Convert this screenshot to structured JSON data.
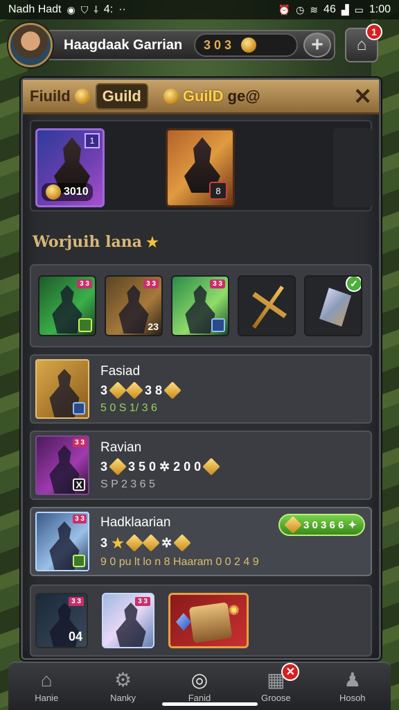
{
  "status_bar": {
    "app_label": "Nadh Hadt",
    "left_num": "4:",
    "right_text": "46",
    "time": "1:00"
  },
  "header": {
    "player_name": "Haagdaak Garrian",
    "gold_value": "3 0 3",
    "mail_badge": "1"
  },
  "panel": {
    "tab_field": "Fiuild",
    "tab_guild": "Guild",
    "guild_title": "GuilD",
    "guild_title_suffix": "ge@",
    "featured": [
      {
        "value": "3010",
        "rank": "1"
      },
      {
        "badge": "8"
      }
    ],
    "section_title": "Worjuih lana",
    "units": [
      {
        "tag": "3 3",
        "level": ""
      },
      {
        "tag": "3 3",
        "level": "23"
      },
      {
        "tag": "3 3",
        "level": ""
      }
    ],
    "members": [
      {
        "name": "Fasiad",
        "stats": "3",
        "stats_extra": "3 8",
        "sub": "5 0 S 1/ 3 6"
      },
      {
        "name": "Ravian",
        "stats": "3",
        "stats_extra": "3 5 0 ✲ 2 0 0",
        "sub": "S P 2 3 6 5"
      },
      {
        "name": "Hadklaarian",
        "stats": "3",
        "stats_extra": "",
        "sub": "9 0 pu lt lo n 8 Haaram 0 0 2 4 9",
        "reward": "3 0 3 6 6"
      }
    ],
    "bottom_cards": [
      {
        "tag": "3 3",
        "num": "04"
      },
      {
        "tag": "3 3",
        "num": ""
      }
    ]
  },
  "nav": {
    "items": [
      {
        "label": "Hanie",
        "icon": "home-icon"
      },
      {
        "label": "Nanky",
        "icon": "gear-icon"
      },
      {
        "label": "Fanid",
        "icon": "ring-icon"
      },
      {
        "label": "Groose",
        "icon": "chart-icon",
        "badge": "✕"
      },
      {
        "label": "Hosoh",
        "icon": "person-icon"
      }
    ]
  }
}
